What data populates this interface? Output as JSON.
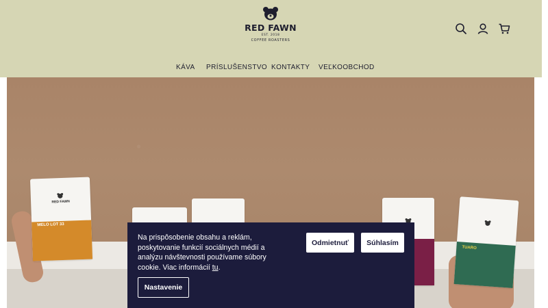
{
  "brand": {
    "name": "RED FAWN",
    "established": "EST. 2018",
    "tagline": "COFFEE ROASTERS"
  },
  "header_icons": [
    "search-icon",
    "account-icon",
    "cart-icon"
  ],
  "nav": {
    "items": [
      "KÁVA",
      "PRÍSLUŠENSTVO",
      "KONTAKTY",
      "VEĽKOOBCHOD"
    ]
  },
  "hero": {
    "bags": [
      {
        "brand": "RED FAWN",
        "title": "MELO LOT 33"
      },
      {
        "brand": "",
        "title": ""
      },
      {
        "brand": "",
        "title": ""
      },
      {
        "brand": "",
        "title": ""
      },
      {
        "brand": "",
        "title": "TUARO"
      }
    ]
  },
  "cookie": {
    "text": "Na prispôsobenie obsahu a reklám, poskytovanie funkcií sociálnych médií a analýzu návštevnosti používame súbory cookie. Viac informácií ",
    "link": "tu",
    "after": ".",
    "reject_label": "Odmietnuť",
    "accept_label": "Súhlasím",
    "settings_label": "Nastavenie"
  },
  "colors": {
    "header_bg": "#d6d6b4",
    "cookie_bg": "#1c1c3c",
    "text_dark": "#1e1e2e"
  }
}
